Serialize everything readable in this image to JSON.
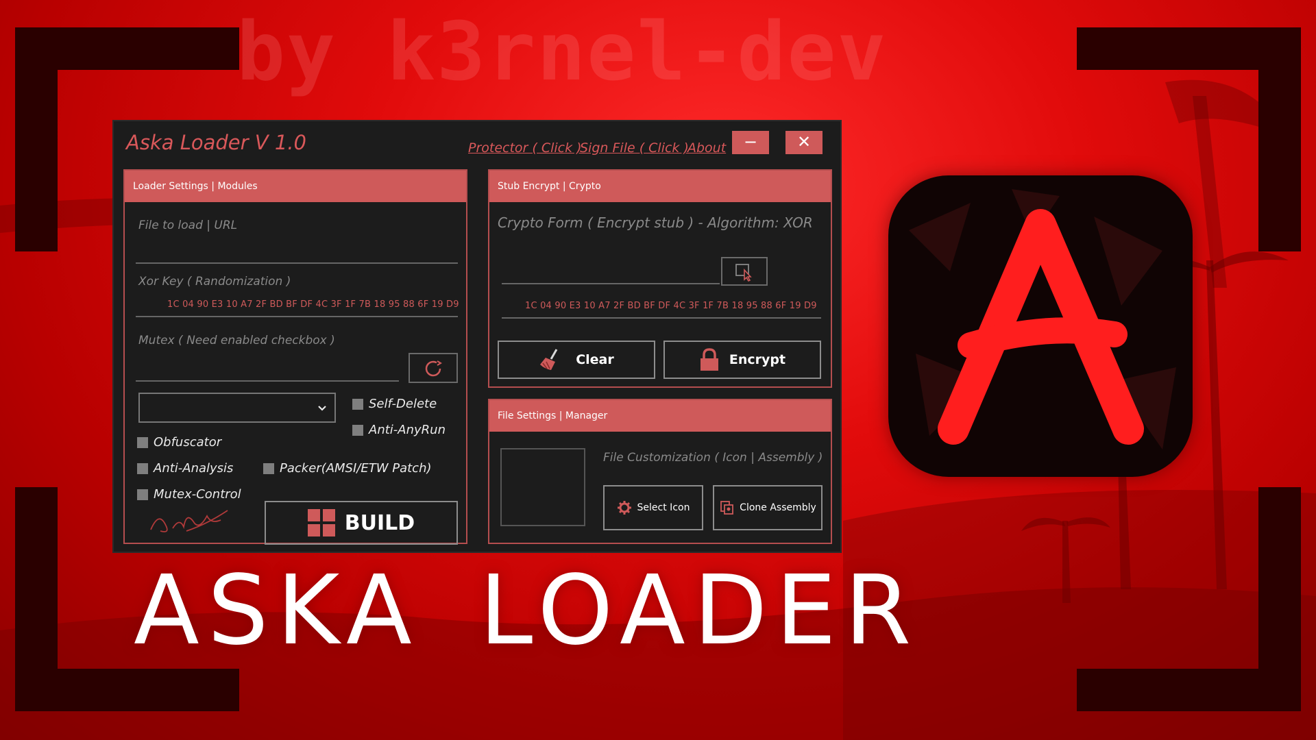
{
  "background": {
    "watermark": "by k3rnel-dev",
    "headline": "ASKA LOADER",
    "logo_letter": "A"
  },
  "colors": {
    "accent": "#cf5a5a",
    "window_bg": "#1c1c1c",
    "background_red": "#e10b0b",
    "logo_red": "#ff1e1e"
  },
  "window": {
    "title": "Aska Loader V 1.0",
    "links": {
      "protector": "Protector ( Click )",
      "sign_file": "Sign File ( Click )",
      "about": "About"
    },
    "controls": {
      "minimize": "−",
      "close": "✕"
    }
  },
  "loader_panel": {
    "header": "Loader Settings | Modules",
    "file_placeholder": "File to load | URL",
    "xor_label": "Xor Key ( Randomization )",
    "xor_value": "1C 04 90 E3 10 A7 2F BD BF DF 4C 3F 1F 7B 18 95 88 6F 19 D9",
    "mutex_placeholder": "Mutex ( Need enabled checkbox )",
    "select_value": "",
    "checkboxes": {
      "self_delete": "Self-Delete",
      "anti_anyrun": "Anti-AnyRun",
      "obfuscator": "Obfuscator",
      "anti_analysis": "Anti-Analysis",
      "packer": "Packer(AMSI/ETW Patch)",
      "mutex_control": "Mutex-Control"
    },
    "build_label": "BUILD"
  },
  "stub_panel": {
    "header": "Stub Encrypt | Crypto",
    "crypto_label": "Crypto Form ( Encrypt stub ) - Algorithm: XOR",
    "key_value": "1C 04 90 E3 10 A7 2F BD BF DF 4C 3F 1F 7B 18 95 88 6F 19 D9",
    "clear_label": "Clear",
    "encrypt_label": "Encrypt"
  },
  "file_panel": {
    "header": "File Settings | Manager",
    "customization_label": "File Customization ( Icon | Assembly )",
    "select_icon_label": "Select Icon",
    "clone_assembly_label": "Clone Assembly"
  },
  "icons": {
    "browse": "cursor-click-icon",
    "refresh": "refresh-icon",
    "broom": "broom-icon",
    "lock": "lock-icon",
    "windows": "windows-logo-icon",
    "gear": "gear-icon",
    "clone": "clone-icon",
    "chevron": "chevron-down-icon"
  }
}
